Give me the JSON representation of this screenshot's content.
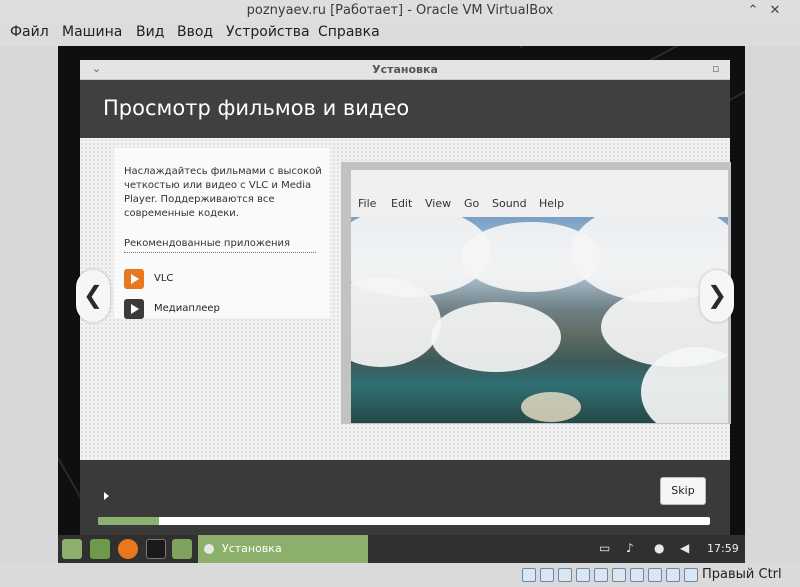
{
  "host_window": {
    "title": "poznyaev.ru [Работает] - Oracle VM VirtualBox",
    "controls": {
      "minimize": "⌃",
      "close": "✕"
    }
  },
  "host_menu": [
    "Файл",
    "Машина",
    "Вид",
    "Ввод",
    "Устройства",
    "Справка"
  ],
  "installer": {
    "window_title": "Установка",
    "heading": "Просмотр фильмов и видео",
    "description": "Наслаждайтесь фильмами с высокой четкостью или видео с VLC и Media Player. Поддерживаются все современные кодеки.",
    "recommended_label": "Рекомендованные приложения",
    "apps": [
      {
        "label": "VLC",
        "icon": "vlc-icon",
        "color": "#e8771e"
      },
      {
        "label": "Медиаплеер",
        "icon": "media-player-icon",
        "color": "#3b3b3b"
      }
    ],
    "player_menu": [
      "File",
      "Edit",
      "View",
      "Go",
      "Sound",
      "Help"
    ],
    "prev_arrow": "❮",
    "next_arrow": "❯",
    "skip_label": "Skip",
    "progress": 0.1
  },
  "taskbar": {
    "task_label": "Установка",
    "clock": "17:59",
    "launchers": [
      "mint-menu-icon",
      "files-icon",
      "firefox-icon",
      "terminal-icon",
      "folder-icon"
    ],
    "tray": [
      "display-icon",
      "bell-icon",
      "network-icon",
      "volume-icon"
    ]
  },
  "statusbar": {
    "hostkey": "Правый Ctrl"
  },
  "colors": {
    "mint_green": "#8cb06b",
    "vlc_orange": "#e8771e",
    "header_dark": "#404040"
  }
}
